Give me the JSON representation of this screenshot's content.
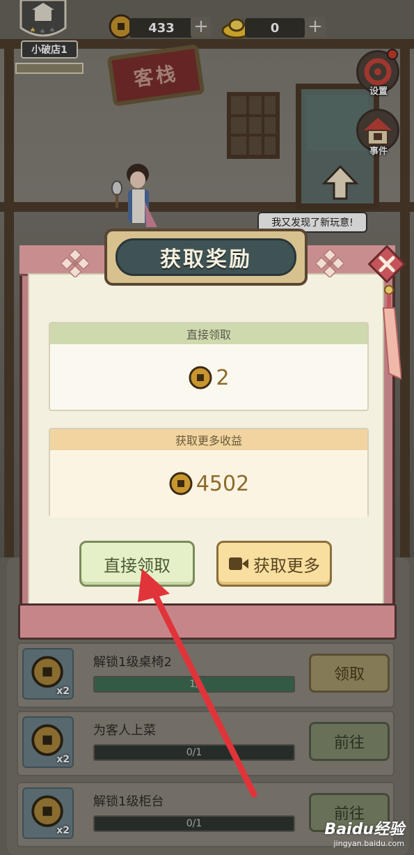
{
  "hud": {
    "shop_name": "小破店1",
    "coin_count": "433",
    "ingot_count": "0",
    "plus": "+"
  },
  "side_menu": {
    "settings_label": "设置",
    "events_label": "事件"
  },
  "scene": {
    "sign_text": "客栈",
    "speech_bubble": "我又发现了新玩意!"
  },
  "modal": {
    "title": "获取奖励",
    "direct_header": "直接领取",
    "direct_value": "2",
    "more_header": "获取更多收益",
    "more_value": "4502",
    "direct_button": "直接领取",
    "more_button": "获取更多"
  },
  "tasks": [
    {
      "title": "解锁1级桌椅2",
      "multiplier": "x2",
      "progress_text": "1/",
      "progress": 1.0,
      "button": "领取",
      "button_style": "gold"
    },
    {
      "title": "为客人上菜",
      "multiplier": "x2",
      "progress_text": "0/1",
      "progress": 0.0,
      "button": "前往",
      "button_style": "green"
    },
    {
      "title": "解锁1级柜台",
      "multiplier": "x2",
      "progress_text": "0/1",
      "progress": 0.0,
      "button": "前往",
      "button_style": "green"
    }
  ],
  "watermark": {
    "main": "Baidu经验",
    "sub": "jingyan.baidu.com"
  },
  "colors": {
    "modal_pink": "#bb7f83",
    "title_teal": "#3f5355",
    "arrow_red": "#e0343a"
  }
}
